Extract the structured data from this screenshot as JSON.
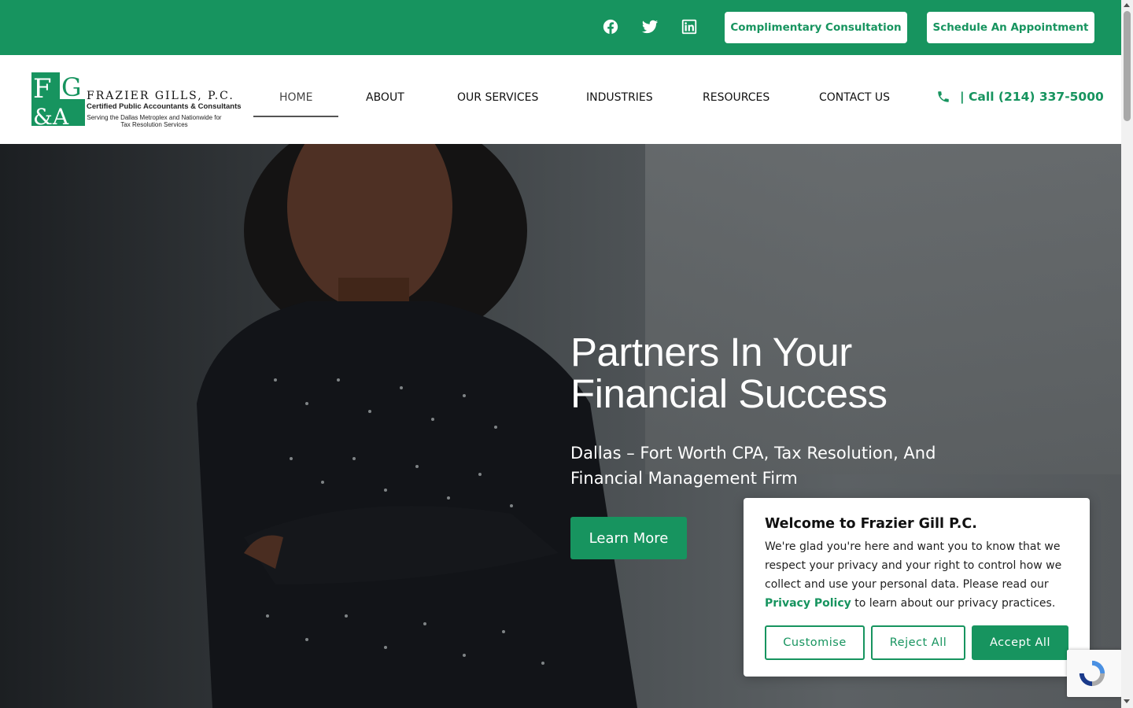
{
  "topbar": {
    "social_icons": [
      "facebook-icon",
      "twitter-icon",
      "linkedin-icon"
    ],
    "consultation_label": "Complimentary Consultation",
    "appointment_label": "Schedule An Appointment",
    "bg_color": "#17945f"
  },
  "logo": {
    "name": "FRAZIER GILLS, P.C.",
    "subtitle": "Certified Public Accountants & Consultants",
    "tagline": "Serving the Dallas Metroplex and Nationwide for Tax Resolution Services"
  },
  "nav": {
    "items": [
      {
        "label": "HOME",
        "active": true
      },
      {
        "label": "ABOUT"
      },
      {
        "label": "OUR SERVICES"
      },
      {
        "label": "INDUSTRIES"
      },
      {
        "label": "RESOURCES"
      },
      {
        "label": "CONTACT US"
      }
    ],
    "phone_label": "| Call (214) 337-5000"
  },
  "hero": {
    "title_line1": "Partners In Your",
    "title_line2": "Financial Success",
    "subtitle": "Dallas – Fort Worth CPA, Tax Resolution, And Financial Management Firm",
    "button_label": "Learn More"
  },
  "cookie": {
    "title": "Welcome to Frazier Gill P.C.",
    "text_before": "We're glad you're here and want you to know that we respect your privacy and your right to control how we collect and use your personal data. Please read our ",
    "link_label": "Privacy Policy",
    "text_after": " to learn about our privacy practices.",
    "customise_label": "Customise",
    "reject_label": "Reject All",
    "accept_label": "Accept All"
  },
  "colors": {
    "brand_green": "#17945f"
  }
}
